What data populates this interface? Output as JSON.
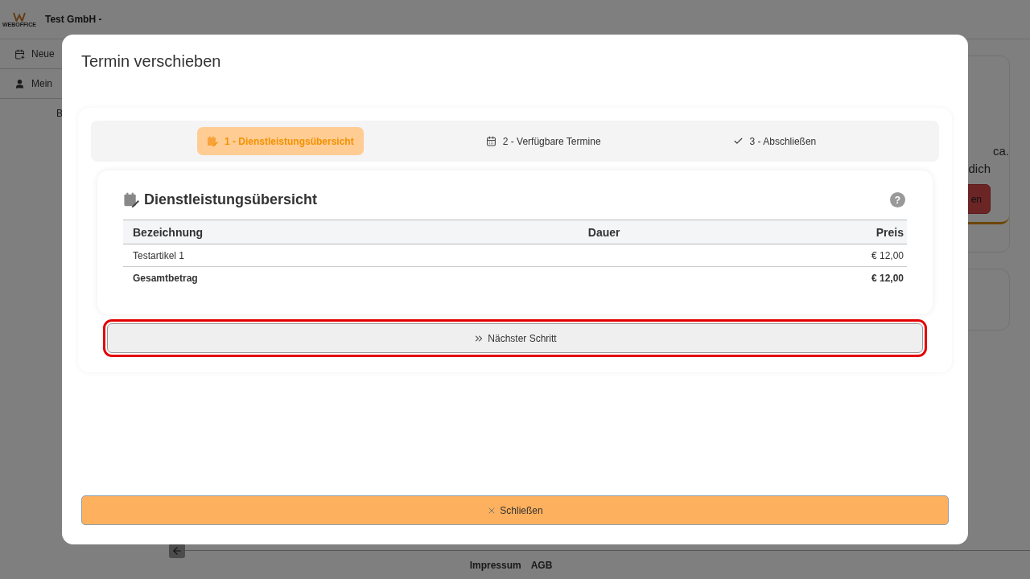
{
  "background": {
    "logo_text": "WEBOFFICE",
    "company": "Test GmbH -",
    "sidebar_items": [
      {
        "label": "Neue"
      },
      {
        "label": "Mein"
      }
    ],
    "main_letter": "B",
    "card_lines": [
      "ca.",
      "dich"
    ],
    "card_button": "en",
    "footer_links": [
      "Impressum",
      "AGB"
    ]
  },
  "dialog": {
    "title": "Termin verschieben",
    "steps": [
      {
        "label": "1 - Dienstleistungsübersicht",
        "selected": true
      },
      {
        "label": "2 - Verfügbare Termine",
        "selected": false
      },
      {
        "label": "3 - Abschließen",
        "selected": false
      }
    ],
    "section_title": "Dienstleistungsübersicht",
    "help": "?",
    "table": {
      "columns": [
        "Bezeichnung",
        "Dauer",
        "Preis"
      ],
      "rows": [
        {
          "kind": "item",
          "cells": [
            "Testartikel 1",
            "",
            "€ 12,00"
          ]
        },
        {
          "kind": "total",
          "cells": [
            "Gesamtbetrag",
            "",
            "€ 12,00"
          ]
        }
      ]
    },
    "next_button": {
      "label": "Nächster Schritt",
      "focused": true
    },
    "close_button": "Schließen"
  }
}
